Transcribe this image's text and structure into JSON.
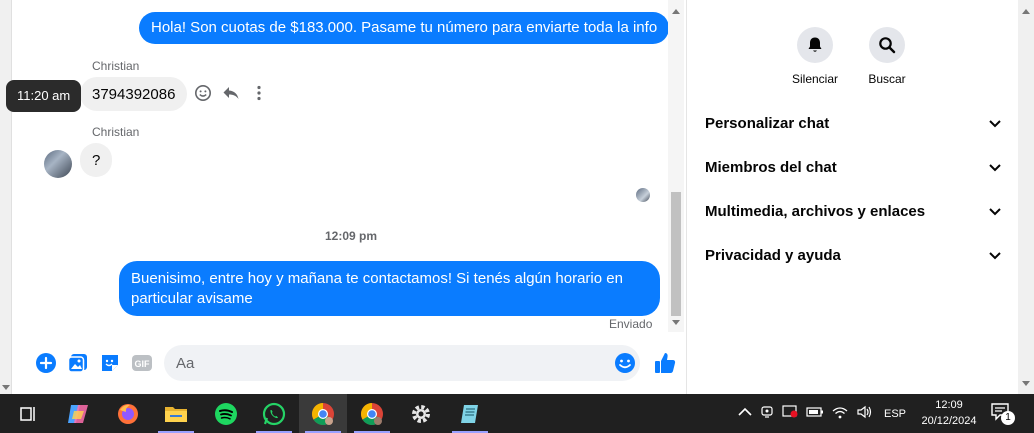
{
  "chat": {
    "messages": [
      {
        "type": "outgoing",
        "text": "Hola! Son cuotas de $183.000. Pasame tu número para enviarte toda la info"
      },
      {
        "type": "incoming",
        "sender": "Christian",
        "text": "3794392086"
      },
      {
        "type": "incoming",
        "sender": "Christian",
        "text": "?"
      },
      {
        "type": "outgoing",
        "text": "Buenisimo, entre hoy y mañana te contactamos! Si tenés algún horario en particular avisame"
      }
    ],
    "hover_time": "11:20 am",
    "time_separator": "12:09 pm",
    "delivery_status": "Enviado"
  },
  "composer": {
    "placeholder": "Aa",
    "icons": [
      "plus-circle-icon",
      "image-icon",
      "sticker-icon",
      "gif-icon",
      "emoji-icon",
      "thumbs-up-icon"
    ],
    "gif_label": "GIF"
  },
  "right_panel": {
    "actions": [
      {
        "label": "Silenciar",
        "icon": "bell-icon"
      },
      {
        "label": "Buscar",
        "icon": "search-icon"
      }
    ],
    "sections": [
      {
        "label": "Personalizar chat"
      },
      {
        "label": "Miembros del chat"
      },
      {
        "label": "Multimedia, archivos y enlaces"
      },
      {
        "label": "Privacidad y ayuda"
      }
    ]
  },
  "taskbar": {
    "apps": [
      "task-view-icon",
      "copilot-icon",
      "firefox-icon",
      "file-explorer-icon",
      "spotify-icon",
      "whatsapp-icon",
      "chrome-icon",
      "chrome-profile-icon",
      "settings-icon",
      "notepad-icon"
    ],
    "language": "ESP",
    "time": "12:09",
    "date": "20/12/2024",
    "notifications": "1"
  },
  "colors": {
    "accent": "#0a7cff",
    "taskbar": "#202020"
  }
}
